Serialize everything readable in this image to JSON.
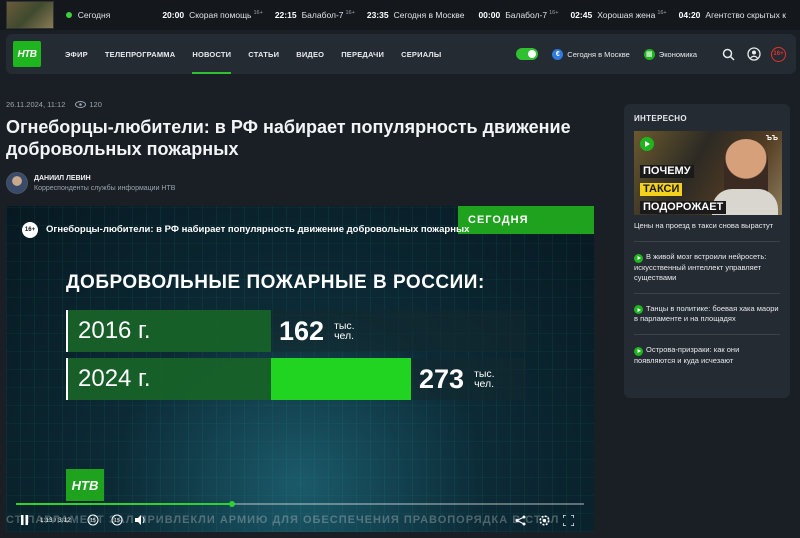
{
  "top_strip": {
    "now_label": "Сегодня",
    "programs": [
      {
        "time": "20:00",
        "name": "Скорая помощь",
        "age": "16+"
      },
      {
        "time": "22:15",
        "name": "Балабол-7",
        "age": "16+"
      },
      {
        "time": "23:35",
        "name": "Сегодня в Москве",
        "age": ""
      },
      {
        "time": "00:00",
        "name": "Балабол-7",
        "age": "16+"
      },
      {
        "time": "02:45",
        "name": "Хорошая жена",
        "age": "16+"
      },
      {
        "time": "04:20",
        "name": "Агентство скрытых к",
        "age": ""
      }
    ]
  },
  "nav": {
    "logo": "НТВ",
    "menu": [
      "ЭФИР",
      "ТЕЛЕПРОГРАММА",
      "НОВОСТИ",
      "СТАТЬИ",
      "ВИДЕО",
      "ПЕРЕДАЧИ",
      "СЕРИАЛЫ"
    ],
    "active_index": 2,
    "chip_moscow": "Сегодня в Москве",
    "chip_economy": "Экономика",
    "age": "16+"
  },
  "article": {
    "date": "26.11.2024, 11:12",
    "views": "120",
    "title": "Огнеборцы-любители: в РФ набирает популярность движение добровольных пожарных",
    "author_name": "ДАНИИЛ ЛЕВИН",
    "author_role": "Корреспонденты службы информации НТВ"
  },
  "video": {
    "brand": "СЕГОДНЯ",
    "age": "16+",
    "title": "Огнеборцы-любители: в РФ набирает популярность движение добровольных пожарных",
    "heading": "ДОБРОВОЛЬНЫЕ ПОЖАРНЫЕ В РОССИИ:",
    "rows": [
      {
        "year": "2016 г.",
        "value": "162",
        "unit_line1": "тыс.",
        "unit_line2": "чел."
      },
      {
        "year": "2024 г.",
        "value": "273",
        "unit_line1": "тыс.",
        "unit_line2": "чел."
      }
    ],
    "logo": "НТВ",
    "ticker": "СТ ПАРЛАМЕНТ ЗАЛ ПРИВЛЕКЛИ АРМИЮ ДЛЯ ОБЕСПЕЧЕНИЯ ПРАВОПОРЯДКА В СТОЛ",
    "time": "1:13 / 3:12",
    "progress": 0.38
  },
  "chart_data": {
    "type": "bar",
    "title": "ДОБРОВОЛЬНЫЕ ПОЖАРНЫЕ В РОССИИ:",
    "categories": [
      "2016 г.",
      "2024 г."
    ],
    "values": [
      162,
      273
    ],
    "unit": "тыс. чел."
  },
  "sidebar": {
    "heading": "ИНТЕРЕСНО",
    "thumb_lines": [
      "ПОЧЕМУ",
      "ТАКСИ",
      "ПОДОРОЖАЕТ"
    ],
    "thumb_brand": "ЪЪ",
    "main_caption": "Цены на проезд в такси снова вырастут",
    "items": [
      "В живой мозг встроили нейросеть: искусственный интеллект управляет существами",
      "Танцы в политике: боевая хака маори в парламенте и на площадях",
      "Острова-призраки: как они появляются и куда исчезают"
    ]
  },
  "colors": {
    "accent": "#1fb51f",
    "page_bg": "#1a1f26",
    "panel_bg": "#252b33",
    "age_red": "#e0342b"
  }
}
